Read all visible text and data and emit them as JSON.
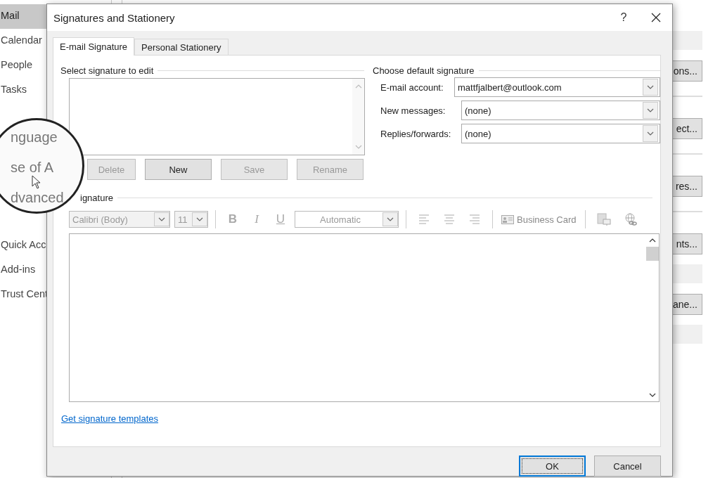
{
  "options_pane": {
    "buttons": [
      "ons...",
      "ect...",
      "res...",
      "nts...",
      "ane..."
    ]
  },
  "sidebar": {
    "groups": [
      [
        {
          "label": "Mail",
          "selected": true
        },
        {
          "label": "Calendar",
          "selected": false
        },
        {
          "label": "People",
          "selected": false
        },
        {
          "label": "Tasks",
          "selected": false
        }
      ],
      [
        {
          "label": "Quick Acc",
          "selected": false
        },
        {
          "label": "Add-ins",
          "selected": false
        },
        {
          "label": "Trust Cent",
          "selected": false
        }
      ]
    ]
  },
  "magnifier": {
    "items": [
      "nguage",
      "se of A",
      "dvanced"
    ]
  },
  "dialog": {
    "title": "Signatures and Stationery",
    "help": "?",
    "tabs": [
      {
        "label": "E-mail Signature",
        "selected": true
      },
      {
        "label": "Personal Stationery",
        "selected": false
      }
    ],
    "select_signature": {
      "heading": "Select signature to edit",
      "buttons": [
        {
          "label": "Delete",
          "disabled": true
        },
        {
          "label": "New",
          "disabled": false
        },
        {
          "label": "Save",
          "disabled": true
        },
        {
          "label": "Rename",
          "disabled": true
        }
      ]
    },
    "default_signature": {
      "heading": "Choose default signature",
      "fields": [
        {
          "label": "E-mail account:",
          "value": "mattfjalbert@outlook.com"
        },
        {
          "label": "New messages:",
          "value": "(none)"
        },
        {
          "label": "Replies/forwards:",
          "value": "(none)"
        }
      ]
    },
    "edit_signature": {
      "heading": "ignature",
      "font": "Calibri (Body)",
      "size": "11",
      "bold": "B",
      "italic": "I",
      "underline": "U",
      "color_name": "Automatic",
      "business_card": "Business Card",
      "disabled": true
    },
    "link": "Get signature templates",
    "buttons": [
      {
        "label": "OK",
        "default": true
      },
      {
        "label": "Cancel",
        "default": false
      }
    ]
  }
}
